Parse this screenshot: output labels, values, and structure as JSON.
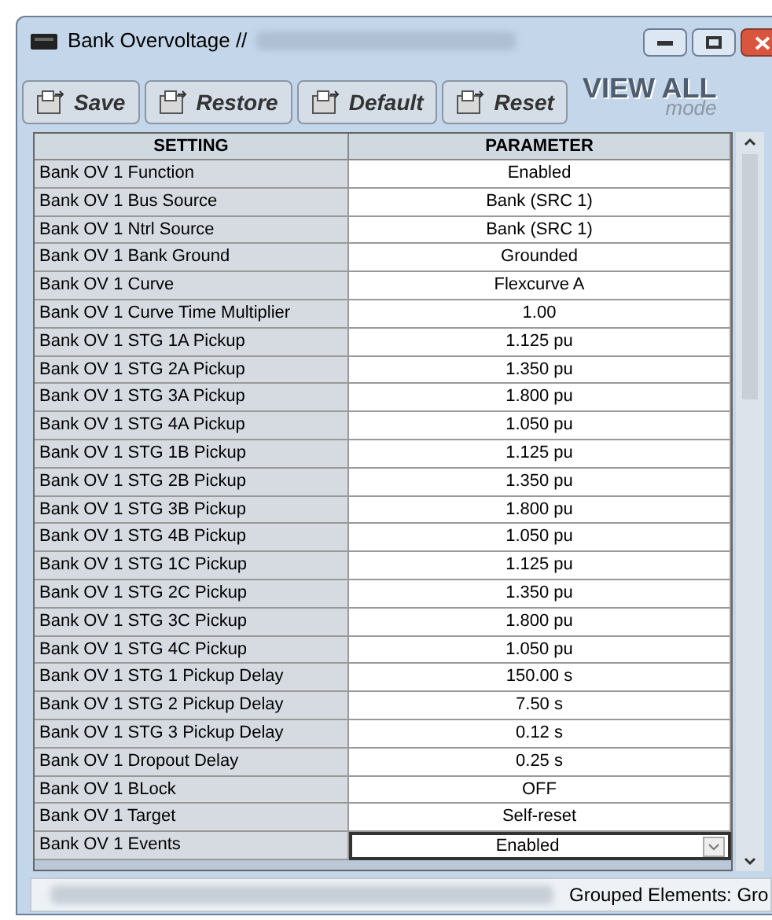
{
  "window": {
    "title": "Bank Overvoltage //"
  },
  "toolbar": {
    "buttons": [
      {
        "label": "Save"
      },
      {
        "label": "Restore"
      },
      {
        "label": "Default"
      },
      {
        "label": "Reset"
      }
    ],
    "mode_title": "VIEW ALL",
    "mode_subtitle": "mode"
  },
  "table": {
    "columns": [
      "SETTING",
      "PARAMETER"
    ],
    "rows": [
      {
        "setting": "Bank OV 1 Function",
        "parameter": "Enabled",
        "kind": "text"
      },
      {
        "setting": "Bank OV 1 Bus Source",
        "parameter": "Bank (SRC 1)",
        "kind": "text"
      },
      {
        "setting": "Bank OV 1 Ntrl Source",
        "parameter": "Bank (SRC 1)",
        "kind": "text"
      },
      {
        "setting": "Bank OV 1 Bank Ground",
        "parameter": "Grounded",
        "kind": "text"
      },
      {
        "setting": "Bank OV 1 Curve",
        "parameter": "Flexcurve A",
        "kind": "text"
      },
      {
        "setting": "Bank OV 1 Curve Time Multiplier",
        "parameter": "1.00",
        "kind": "text"
      },
      {
        "setting": "Bank OV 1 STG 1A Pickup",
        "parameter": "1.125 pu",
        "kind": "text"
      },
      {
        "setting": "Bank OV 1 STG 2A Pickup",
        "parameter": "1.350 pu",
        "kind": "text"
      },
      {
        "setting": "Bank OV 1 STG 3A Pickup",
        "parameter": "1.800 pu",
        "kind": "text"
      },
      {
        "setting": "Bank OV 1 STG 4A Pickup",
        "parameter": "1.050 pu",
        "kind": "text"
      },
      {
        "setting": "Bank OV 1 STG 1B Pickup",
        "parameter": "1.125 pu",
        "kind": "text"
      },
      {
        "setting": "Bank OV 1 STG 2B Pickup",
        "parameter": "1.350 pu",
        "kind": "text"
      },
      {
        "setting": "Bank OV 1 STG 3B Pickup",
        "parameter": "1.800 pu",
        "kind": "text"
      },
      {
        "setting": "Bank OV 1 STG 4B Pickup",
        "parameter": "1.050 pu",
        "kind": "text"
      },
      {
        "setting": "Bank OV 1 STG 1C Pickup",
        "parameter": "1.125 pu",
        "kind": "text"
      },
      {
        "setting": "Bank OV 1 STG 2C Pickup",
        "parameter": "1.350 pu",
        "kind": "text"
      },
      {
        "setting": "Bank OV 1 STG 3C Pickup",
        "parameter": "1.800 pu",
        "kind": "text"
      },
      {
        "setting": "Bank OV 1 STG 4C Pickup",
        "parameter": "1.050 pu",
        "kind": "text"
      },
      {
        "setting": "Bank OV 1 STG 1 Pickup Delay",
        "parameter": "150.00 s",
        "kind": "text"
      },
      {
        "setting": "Bank OV 1 STG 2 Pickup Delay",
        "parameter": "7.50 s",
        "kind": "text"
      },
      {
        "setting": "Bank OV 1 STG 3 Pickup Delay",
        "parameter": "0.12 s",
        "kind": "text"
      },
      {
        "setting": "Bank OV 1 Dropout Delay",
        "parameter": "0.25 s",
        "kind": "text"
      },
      {
        "setting": "Bank OV 1 BLock",
        "parameter": "OFF",
        "kind": "text"
      },
      {
        "setting": "Bank OV 1 Target",
        "parameter": "Self-reset",
        "kind": "text"
      },
      {
        "setting": "Bank OV 1 Events",
        "parameter": "Enabled",
        "kind": "dropdown"
      }
    ]
  },
  "status_bar": {
    "text": "Grouped Elements: Gro"
  }
}
